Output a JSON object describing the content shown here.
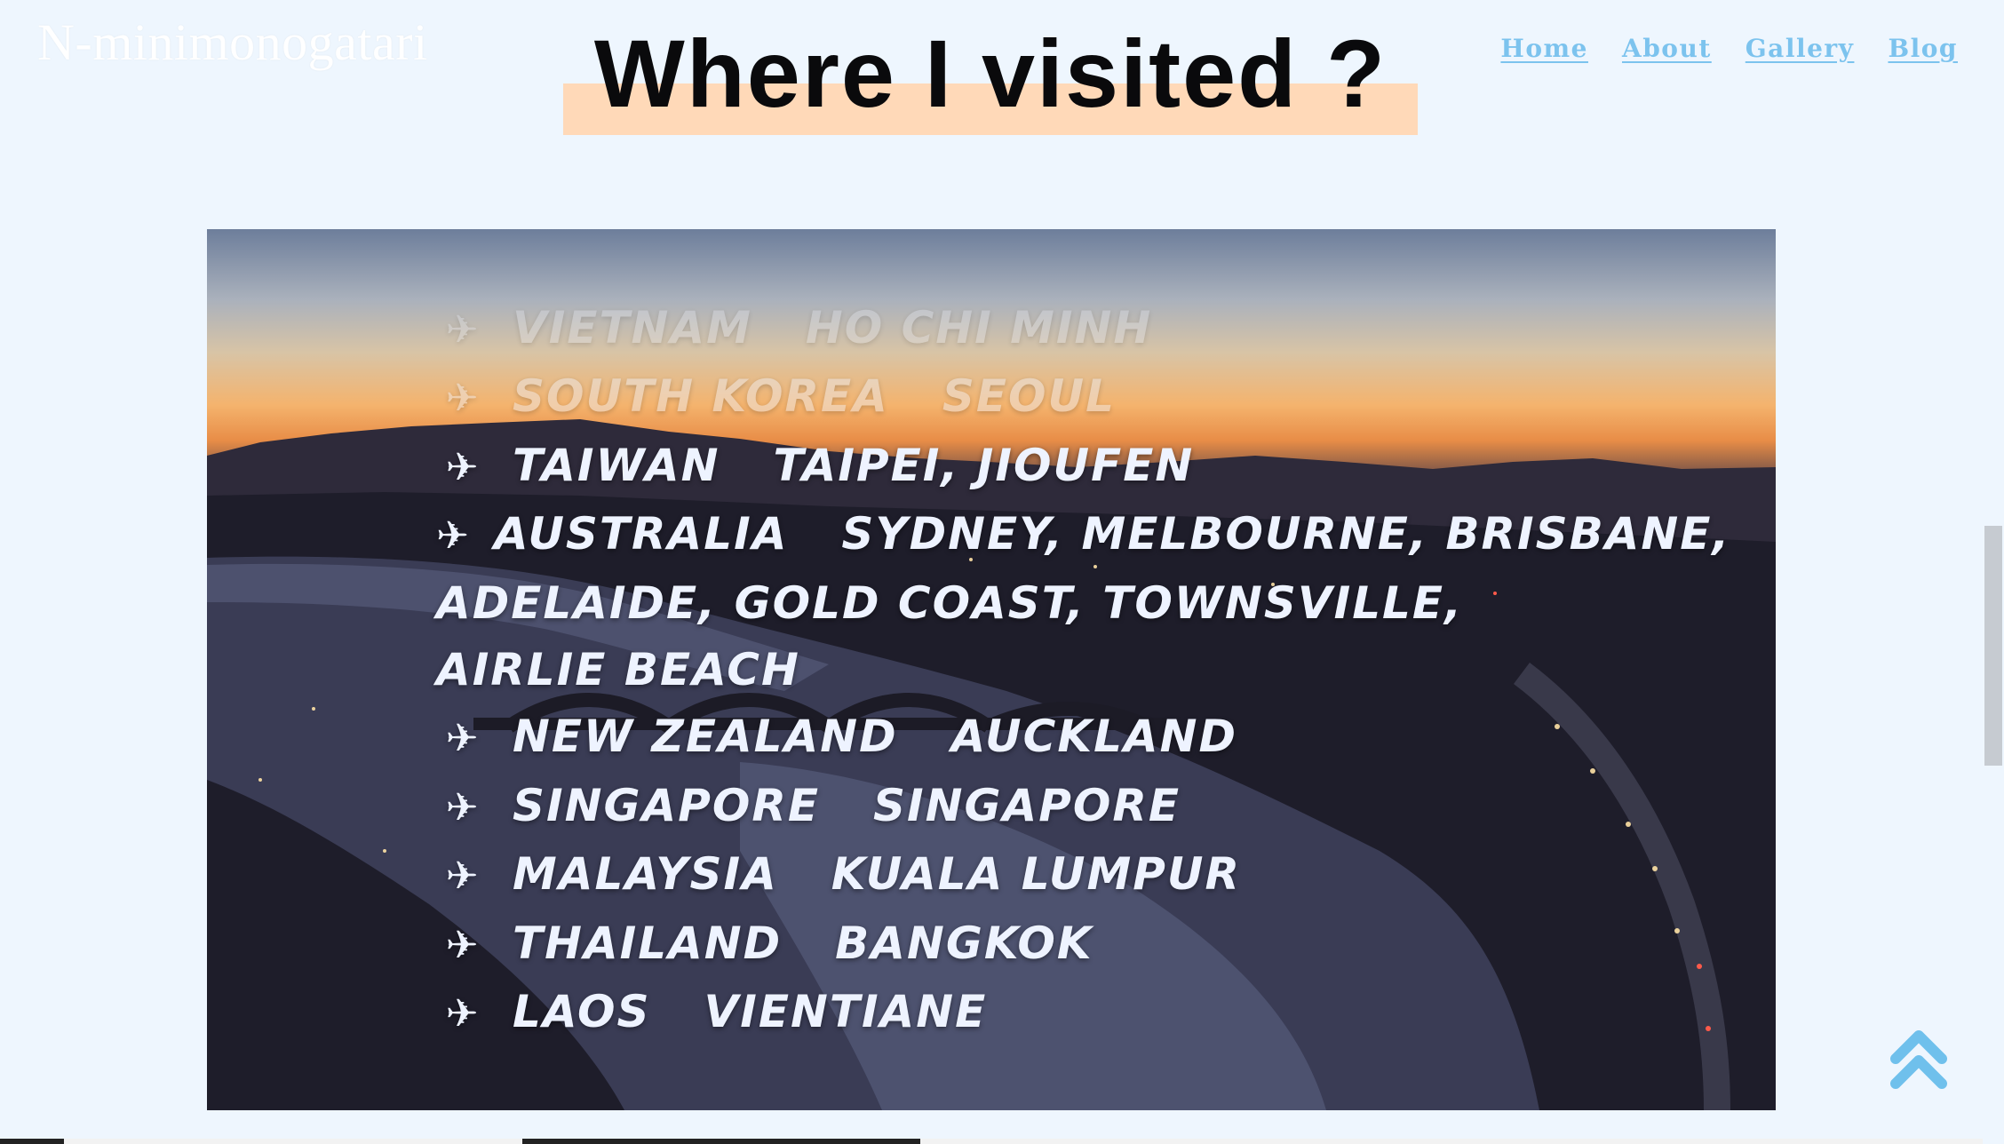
{
  "site": {
    "brand": "N-minimonogatari"
  },
  "nav": {
    "items": [
      "Home",
      "About",
      "Gallery",
      "Blog"
    ]
  },
  "page": {
    "title": "Where I visited ?"
  },
  "visited": {
    "rows": [
      {
        "country": "Vietnam",
        "cities": "Ho Chi Minh"
      },
      {
        "country": "South Korea",
        "cities": "Seoul"
      },
      {
        "country": "Taiwan",
        "cities": "Taipei, Jioufen"
      },
      {
        "country": "Australia",
        "cities": "Sydney, Melbourne, Brisbane,"
      },
      {
        "country": "",
        "cities": "Adelaide, Gold Coast, Townsville,"
      },
      {
        "country": "",
        "cities": "Airlie Beach"
      },
      {
        "country": "New Zealand",
        "cities": "Auckland"
      },
      {
        "country": "Singapore",
        "cities": "Singapore"
      },
      {
        "country": "Malaysia",
        "cities": "Kuala Lumpur"
      },
      {
        "country": "Thailand",
        "cities": "Bangkok"
      },
      {
        "country": "Laos",
        "cities": "Vientiane"
      }
    ]
  },
  "icons": {
    "list_marker": "airplane-icon",
    "scroll_top": "chevron-double-up-icon"
  },
  "colors": {
    "background": "#eef6fe",
    "nav_link": "#7cc3ee",
    "title_highlight": "#ffd9b8",
    "title_text": "#0a0a0c"
  }
}
